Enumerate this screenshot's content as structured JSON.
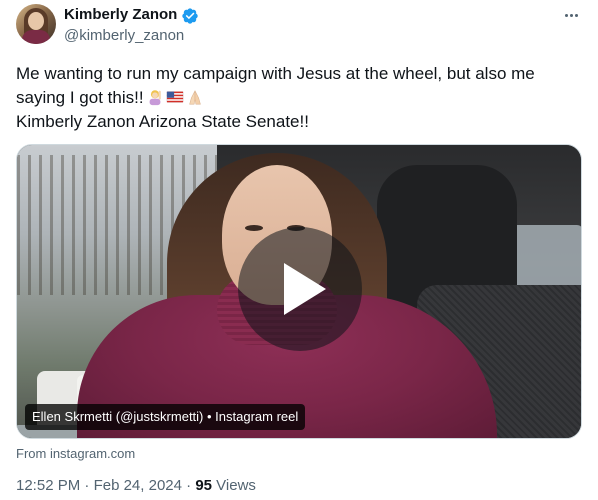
{
  "author": {
    "name": "Kimberly Zanon",
    "handle": "@kimberly_zanon",
    "verified_color": "#1d9bf0",
    "avatar_icon": "avatar-photo",
    "more_icon": "more-horizontal-icon"
  },
  "tweet": {
    "line1": "Me wanting to run my campaign with Jesus at the wheel, but also me",
    "line2": "saying I got this!!",
    "line3": "Kimberly Zanon Arizona State Senate!!",
    "emojis": [
      "woman-raising-hand-emoji",
      "us-flag-emoji",
      "folded-hands-emoji"
    ]
  },
  "media": {
    "caption": "Ellen Skrmetti (@justskrmetti) • Instagram reel",
    "play_icon": "play-icon"
  },
  "source": {
    "text": "From instagram.com"
  },
  "meta": {
    "time": "12:52 PM",
    "separator": "·",
    "date": "Feb 24, 2024",
    "views_count": "95",
    "views_label": "Views"
  }
}
